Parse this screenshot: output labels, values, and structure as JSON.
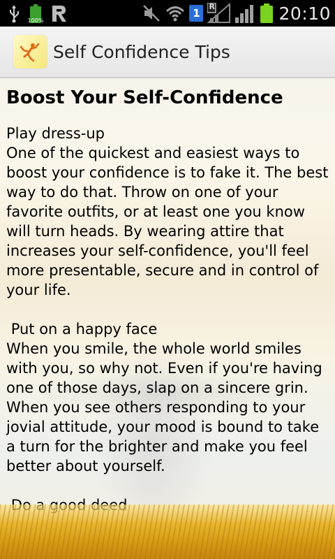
{
  "status_bar": {
    "battery_percent_label": "100%",
    "sim_slot": "1",
    "roaming_letter": "R",
    "time": "20:10",
    "icons": [
      "usb-icon",
      "battery-icon",
      "r-app-icon",
      "mute-icon",
      "wifi-icon",
      "sim-icon",
      "signal-icon",
      "signal-icon",
      "battery-icon"
    ]
  },
  "action_bar": {
    "title": "Self Confidence Tips",
    "app_icon": "app-logo-icon"
  },
  "article": {
    "heading": "Boost Your Self-Confidence",
    "sections": [
      {
        "title": "Play dress-up",
        "body": "One of the quickest and easiest ways to boost your confidence is to fake it. The best way to do that. Throw on one of your favorite outfits, or at least one you know will turn heads. By wearing attire that increases your self-confidence, you'll feel more presentable, secure and in control of your life."
      },
      {
        "title": " Put on a happy face",
        "body": "When you smile, the whole world smiles with you, so why not. Even if you're having one of those days, slap on a sincere grin. When you see others responding to your jovial attitude, your mood is bound to take a turn for the brighter and make you feel better about yourself."
      },
      {
        "title": " Do a good deed",
        "body": ""
      }
    ]
  },
  "colors": {
    "status_bar_bg": "#000000",
    "action_bar_bg": "#eeeeee",
    "battery_green": "#7bd321",
    "sim_blue": "#2a6fd8"
  }
}
